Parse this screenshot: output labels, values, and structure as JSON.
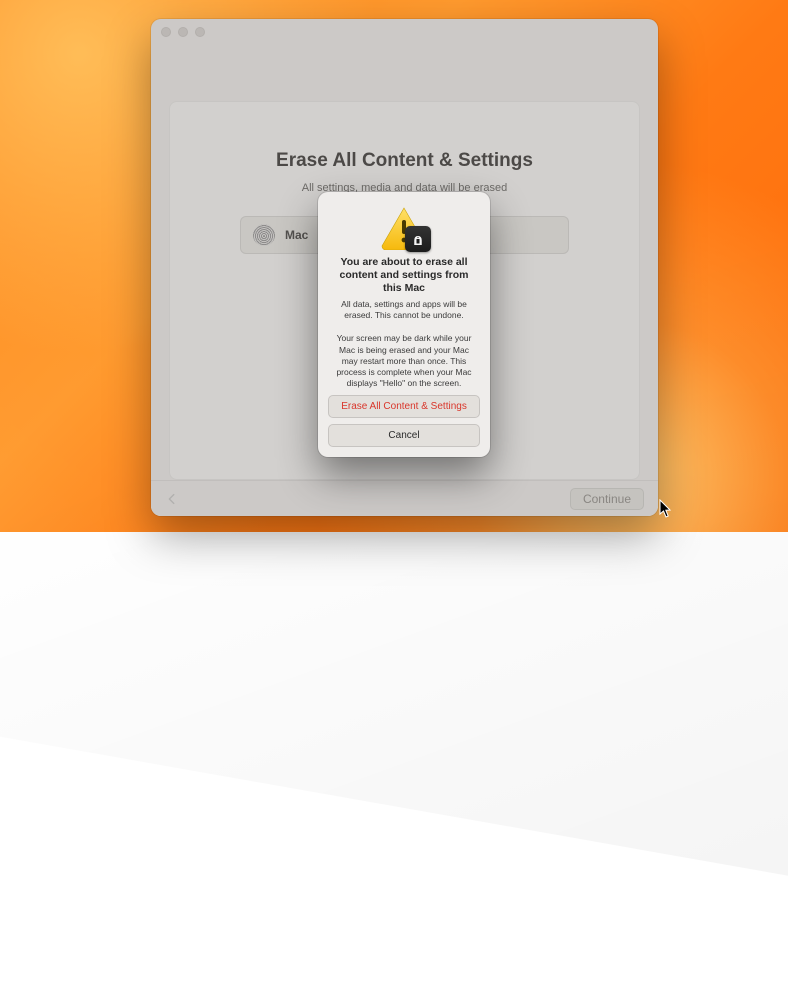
{
  "page": {
    "title": "Erase All Content & Settings",
    "subtitle": "All settings, media and data will be erased"
  },
  "row": {
    "label": "Mac"
  },
  "footer": {
    "continue_label": "Continue"
  },
  "modal": {
    "title": "You are about to erase all content and settings from this Mac",
    "body1": "All data, settings and apps will be erased. This cannot be undone.",
    "body2": "Your screen may be dark while your Mac is being erased and your Mac may restart more than once. This process is complete when your Mac displays \"Hello\" on the screen.",
    "erase_label": "Erase All Content & Settings",
    "cancel_label": "Cancel"
  },
  "colors": {
    "destructive": "#d9362b"
  }
}
